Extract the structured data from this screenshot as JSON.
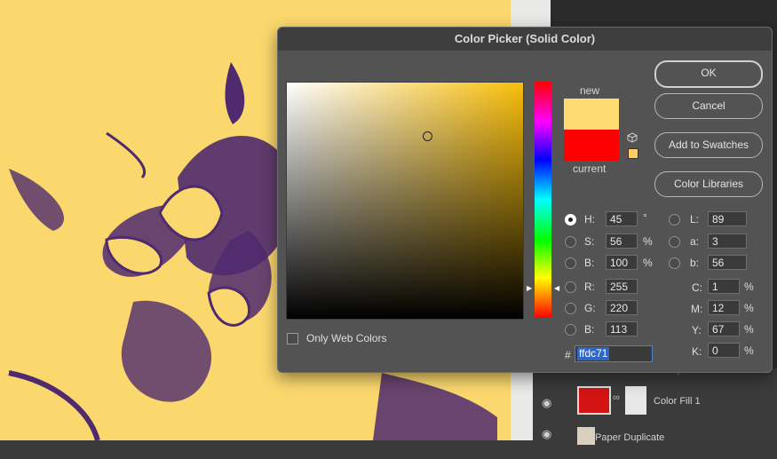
{
  "dialog": {
    "title": "Color Picker (Solid Color)",
    "label_new": "new",
    "label_current": "current",
    "new_color": "#ffdc71",
    "current_color": "#ff0000",
    "hue_base_color": "#f9be0b",
    "only_web_colors": "Only Web Colors"
  },
  "buttons": {
    "ok": "OK",
    "cancel": "Cancel",
    "add_to_swatches": "Add to Swatches",
    "color_libraries": "Color Libraries"
  },
  "hsb": {
    "h_label": "H:",
    "h": "45",
    "h_unit": "°",
    "s_label": "S:",
    "s": "56",
    "s_unit": "%",
    "b_label": "B:",
    "b": "100",
    "b_unit": "%"
  },
  "rgb": {
    "r_label": "R:",
    "r": "255",
    "g_label": "G:",
    "g": "220",
    "b_label": "B:",
    "b": "113"
  },
  "lab": {
    "l_label": "L:",
    "l": "89",
    "a_label": "a:",
    "a": "3",
    "b_label": "b:",
    "b": "56"
  },
  "cmyk": {
    "c_label": "C:",
    "c": "1",
    "m_label": "M:",
    "m": "12",
    "y_label": "Y:",
    "y": "67",
    "k_label": "K:",
    "k": "0",
    "unit": "%"
  },
  "hex": {
    "hash": "#",
    "value": "ffdc71"
  },
  "layers": {
    "row1_label": "Filter Gallery",
    "row2_label": "Color Fill 1",
    "row3_label": "Paper Duplicate"
  },
  "colors": {
    "canvas_yellow": "#fbd86e",
    "canvas_purple": "#4f2a6e",
    "dialog_bg": "#535353"
  }
}
